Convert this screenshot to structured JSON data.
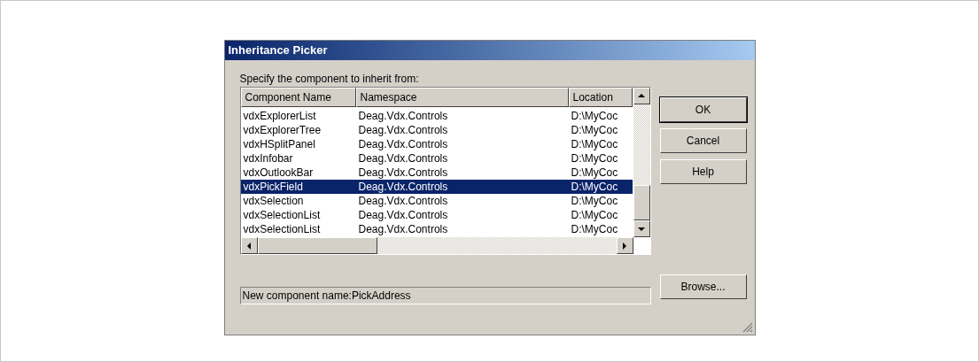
{
  "window": {
    "title": "Inheritance Picker"
  },
  "prompt": "Specify the component to inherit from:",
  "table": {
    "columns": [
      "Component Name",
      "Namespace",
      "Location"
    ],
    "rows": [
      {
        "cells": [
          "vdxExplorerList",
          "Deag.Vdx.Controls",
          "D:\\MyCoc"
        ],
        "selected": false
      },
      {
        "cells": [
          "vdxExplorerTree",
          "Deag.Vdx.Controls",
          "D:\\MyCoc"
        ],
        "selected": false
      },
      {
        "cells": [
          "vdxHSplitPanel",
          "Deag.Vdx.Controls",
          "D:\\MyCoc"
        ],
        "selected": false
      },
      {
        "cells": [
          "vdxInfobar",
          "Deag.Vdx.Controls",
          "D:\\MyCoc"
        ],
        "selected": false
      },
      {
        "cells": [
          "vdxOutlookBar",
          "Deag.Vdx.Controls",
          "D:\\MyCoc"
        ],
        "selected": false
      },
      {
        "cells": [
          "vdxPickField",
          "Deag.Vdx.Controls",
          "D:\\MyCoc"
        ],
        "selected": true
      },
      {
        "cells": [
          "vdxSelection",
          "Deag.Vdx.Controls",
          "D:\\MyCoc"
        ],
        "selected": false
      },
      {
        "cells": [
          "vdxSelectionList",
          "Deag.Vdx.Controls",
          "D:\\MyCoc"
        ],
        "selected": false
      },
      {
        "cells": [
          "vdxSelectionList",
          "Deag.Vdx.Controls",
          "D:\\MyCoc"
        ],
        "selected": false
      }
    ]
  },
  "buttons": [
    {
      "label": "OK",
      "default": true
    },
    {
      "label": "Cancel",
      "default": false
    },
    {
      "label": "Help",
      "default": false
    }
  ],
  "browse_button": "Browse...",
  "status": "New component name:PickAddress"
}
